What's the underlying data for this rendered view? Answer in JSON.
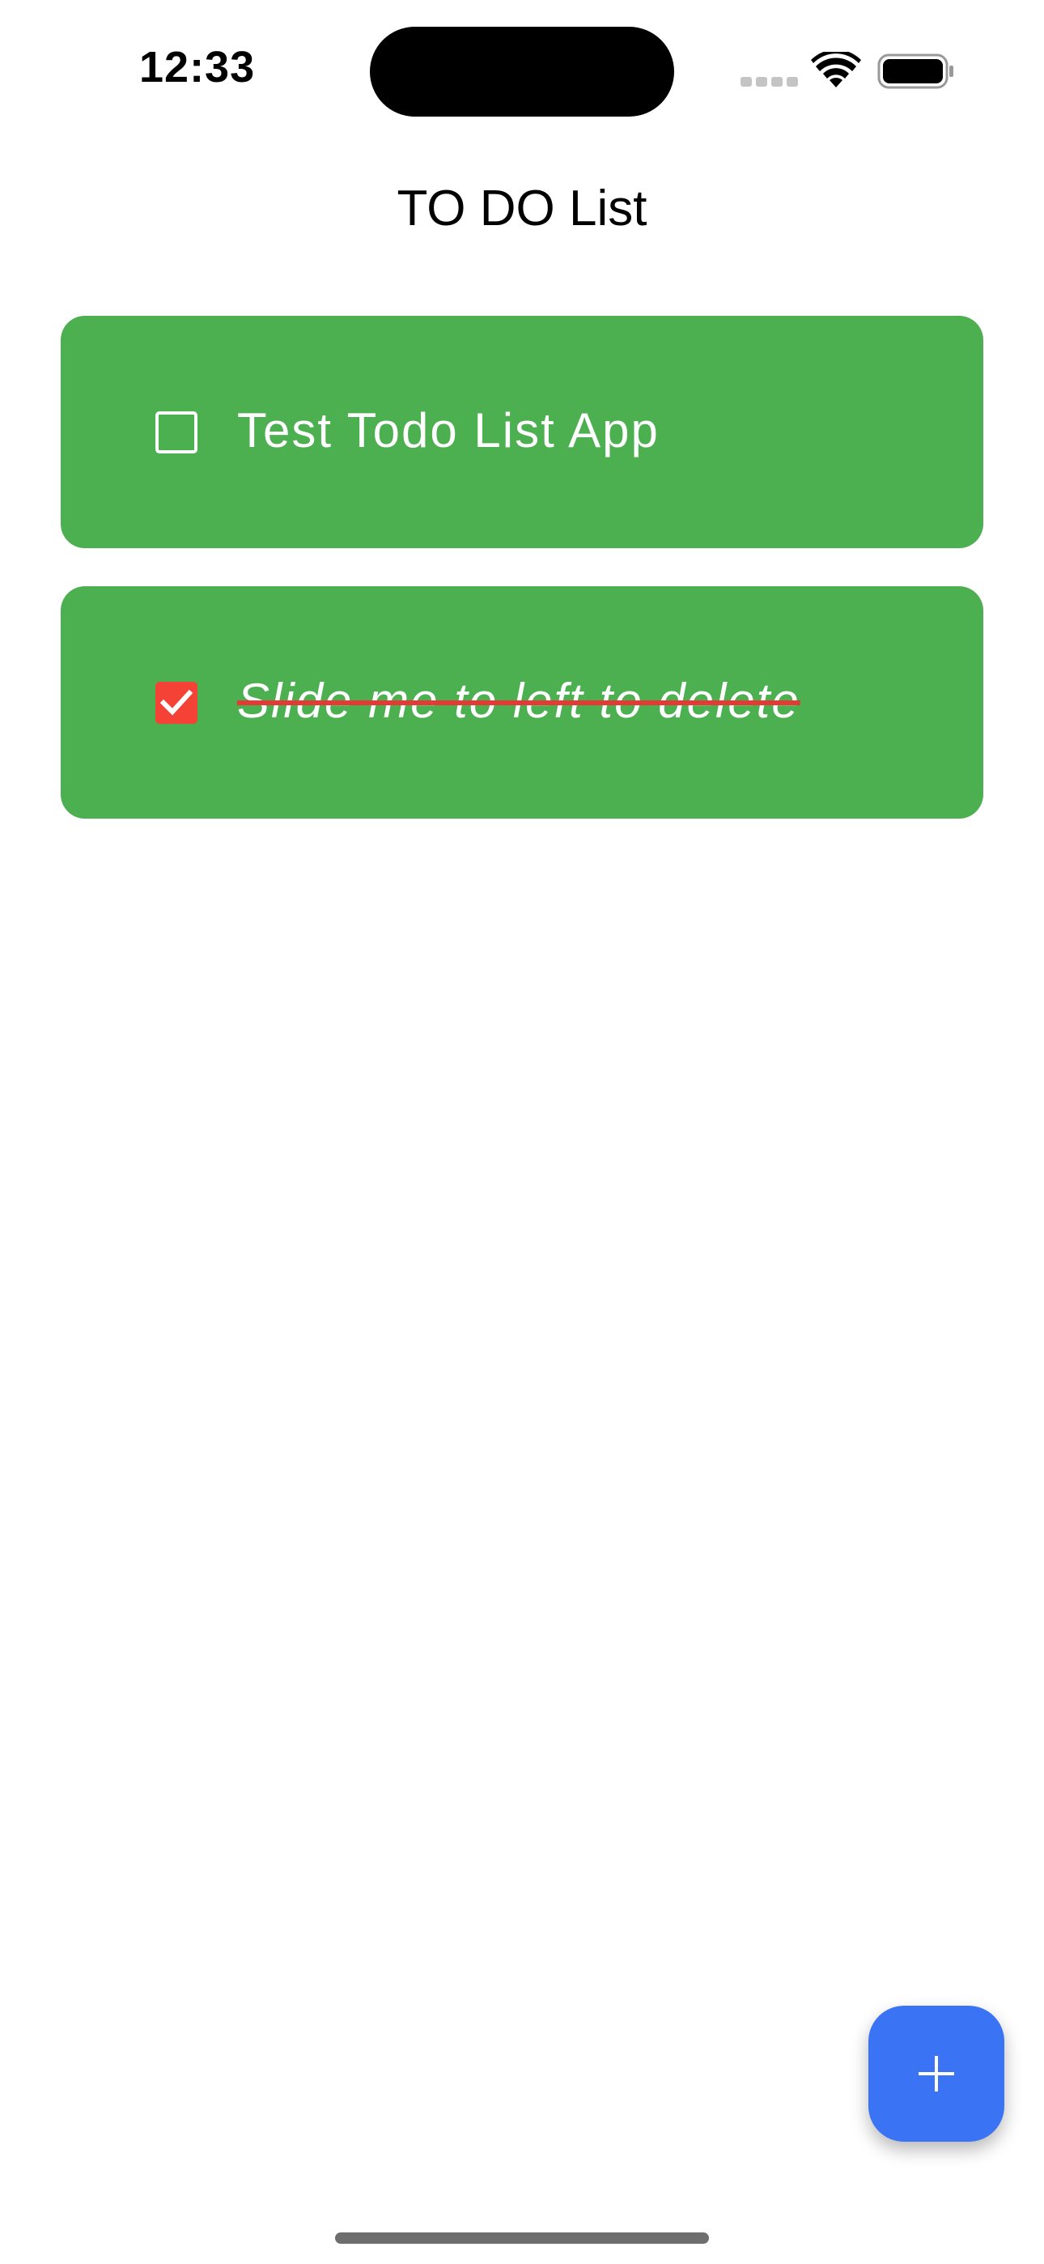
{
  "status_bar": {
    "time": "12:33"
  },
  "header": {
    "title": "TO DO List"
  },
  "todos": [
    {
      "label": "Test Todo List App",
      "checked": false
    },
    {
      "label": "Slide me to left to delete",
      "checked": true
    }
  ],
  "fab": {
    "icon": "plus-icon"
  },
  "colors": {
    "item_background": "#4caf50",
    "checked_box": "#f44336",
    "strikethrough": "#e53935",
    "fab_background": "#3b73f5"
  }
}
